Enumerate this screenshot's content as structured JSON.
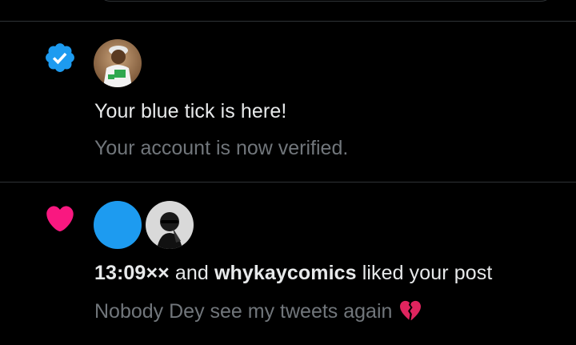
{
  "colors": {
    "background": "#000000",
    "divider": "#2f3336",
    "primary_text": "#e7e9ea",
    "secondary_text": "#71767b",
    "verified_blue": "#1d9bf0",
    "like_pink": "#f91880"
  },
  "notifications": [
    {
      "type_icon": "verified-badge-icon",
      "title": "Your blue tick is here!",
      "subtitle": "Your account is now verified."
    },
    {
      "type_icon": "heart-icon",
      "user1": "13:09××",
      "connector": "and",
      "user2": "whykaycomics",
      "action": "liked your post",
      "post_text": "Nobody Dey see my tweets again",
      "post_emoji": "broken-heart-icon"
    }
  ]
}
